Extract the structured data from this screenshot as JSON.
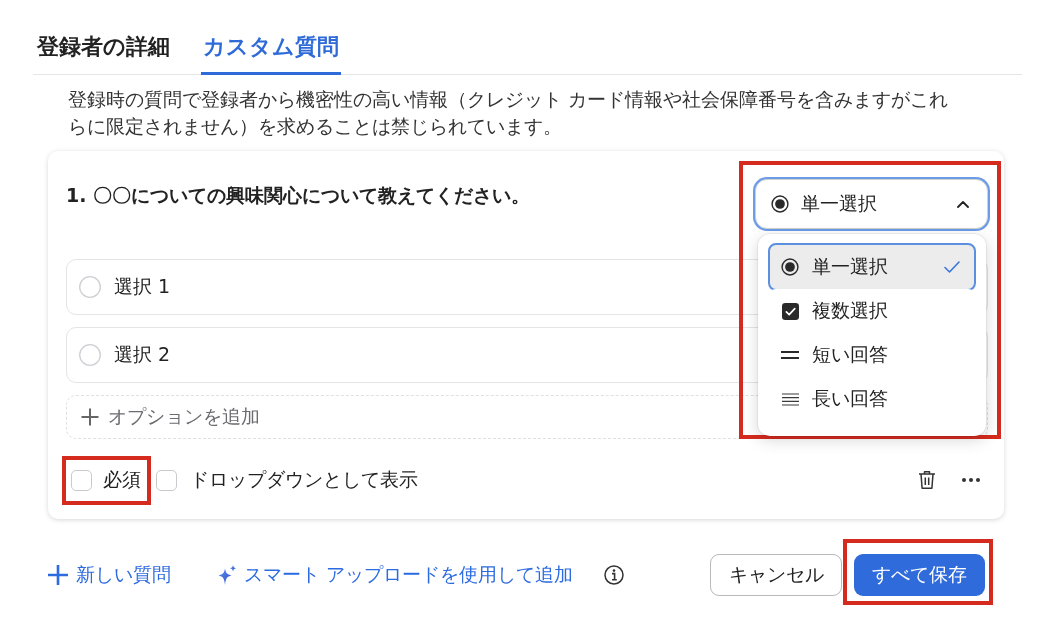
{
  "tabs": [
    {
      "label": "登録者の詳細",
      "selected": false
    },
    {
      "label": "カスタム質問",
      "selected": true
    }
  ],
  "notice": "登録時の質問で登録者から機密性の高い情報（クレジット カード情報や社会保障番号を含みますがこれらに限定されません）を求めることは禁じられています。",
  "question": {
    "title": "1. 〇〇についての興味関心について教えてください。",
    "type_select": {
      "value": "単一選択",
      "kind": "single",
      "expanded": true,
      "highlighted": true
    },
    "type_menu": [
      {
        "label": "単一選択",
        "kind": "single",
        "selected": true
      },
      {
        "label": "複数選択",
        "kind": "multiple",
        "selected": false
      },
      {
        "label": "短い回答",
        "kind": "short",
        "selected": false
      },
      {
        "label": "長い回答",
        "kind": "long",
        "selected": false
      }
    ],
    "options": [
      {
        "label": "選択 1"
      },
      {
        "label": "選択 2"
      }
    ],
    "add_option": "オプションを追加",
    "required": {
      "label": "必須",
      "checked": false,
      "highlighted": true
    },
    "show_as_dropdown": {
      "label": "ドロップダウンとして表示",
      "checked": false
    }
  },
  "footer": {
    "new_question": "新しい質問",
    "smart_upload": "スマート アップロードを使用して追加",
    "cancel": "キャンセル",
    "save_all": {
      "label": "すべて保存",
      "highlighted": true
    }
  }
}
